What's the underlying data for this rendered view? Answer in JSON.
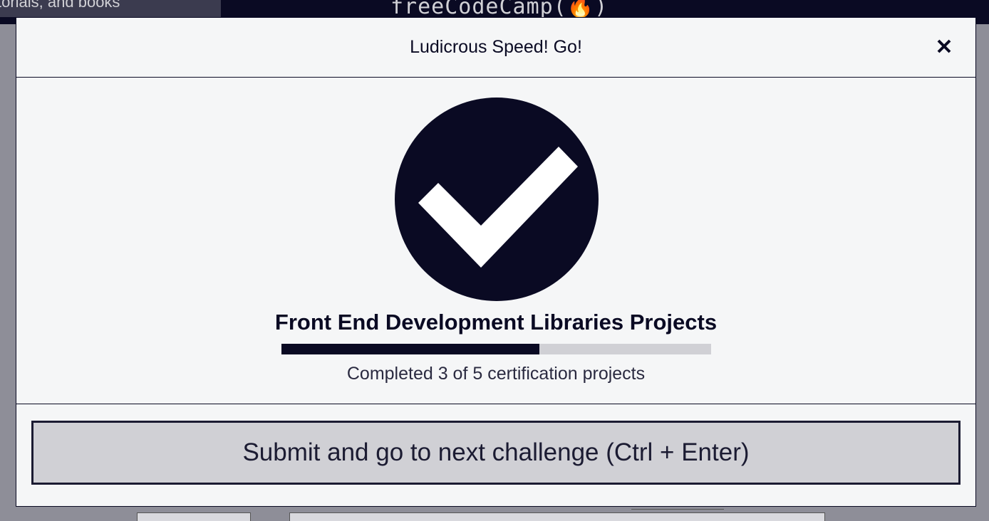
{
  "background": {
    "search_text": "torials, and books",
    "logo_text": "freeCodeCamp(🔥)"
  },
  "modal": {
    "title": "Ludicrous Speed! Go!",
    "close_icon": "close-icon",
    "success_icon": "checkmark-circle-icon",
    "certification_title": "Front End Development Libraries Projects",
    "progress": {
      "completed": 3,
      "total": 5,
      "fraction": 0.6,
      "text": "Completed 3 of 5 certification projects"
    },
    "submit_label": "Submit and go to next challenge (Ctrl + Enter)"
  },
  "colors": {
    "primary_dark": "#0a0a23",
    "modal_bg": "#f5f6f7",
    "track_gray": "#d0d0d5",
    "button_bg": "#d0d0d5"
  }
}
